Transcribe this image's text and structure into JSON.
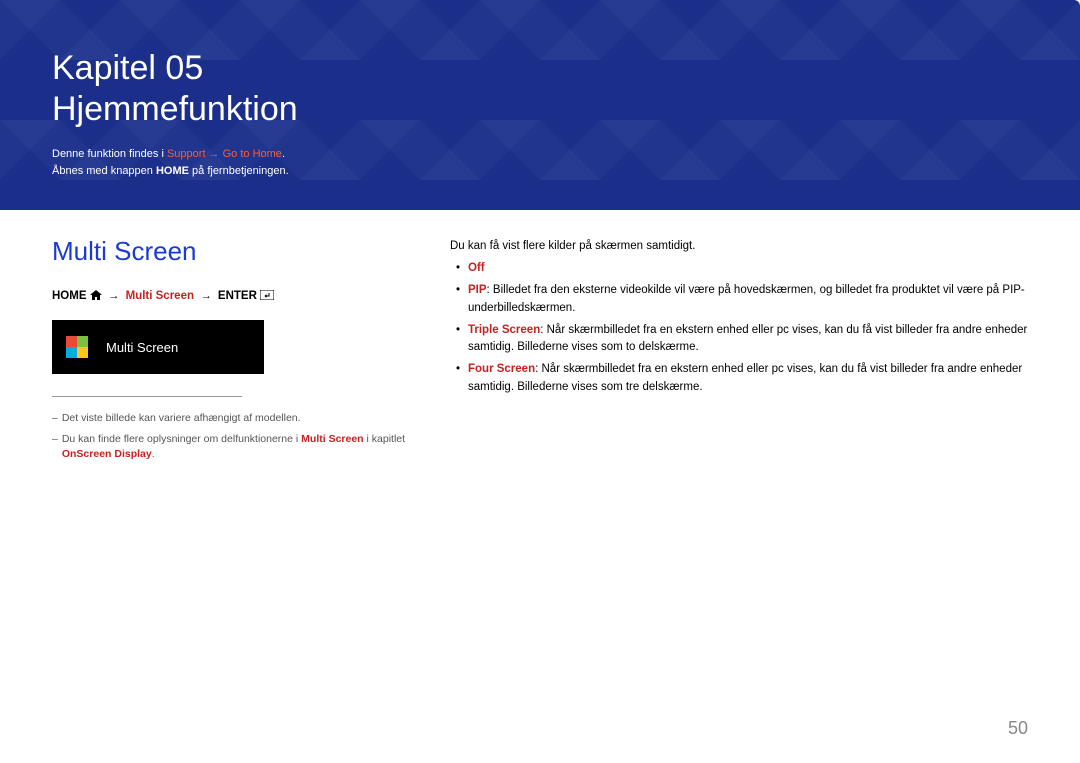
{
  "header": {
    "chapter_label": "Kapitel 05",
    "title": "Hjemmefunktion",
    "intro_line1_prefix": "Denne funktion findes i ",
    "intro_line1_hl1": "Support",
    "intro_line1_arrow": " → ",
    "intro_line1_hl2": "Go to Home",
    "intro_line1_suffix": ".",
    "intro_line2_prefix": "Åbnes med knappen ",
    "intro_line2_bold": "HOME",
    "intro_line2_suffix": " på fjernbetjeningen."
  },
  "left": {
    "section_title": "Multi Screen",
    "breadcrumb": {
      "home_label": "HOME",
      "arrow": "→",
      "mid": "Multi Screen",
      "enter_label": "ENTER"
    },
    "screenshot_label": "Multi Screen",
    "footnote1": "Det viste billede kan variere afhængigt af modellen.",
    "footnote2_prefix": "Du kan finde flere oplysninger om delfunktionerne i ",
    "footnote2_red1": "Multi Screen",
    "footnote2_mid": " i kapitlet ",
    "footnote2_red2": "OnScreen Display",
    "footnote2_suffix": "."
  },
  "right": {
    "intro": "Du kan få vist flere kilder på skærmen samtidigt.",
    "items": {
      "off": "Off",
      "pip_label": "PIP",
      "pip_text": ": Billedet fra den eksterne videokilde vil være på hovedskærmen, og billedet fra produktet vil være på PIP-underbilledskærmen.",
      "triple_label": "Triple Screen",
      "triple_text": ": Når skærmbilledet fra en ekstern enhed eller pc vises, kan du få vist billeder fra andre enheder samtidig. Billederne vises som to delskærme.",
      "four_label": "Four Screen",
      "four_text": ": Når skærmbilledet fra en ekstern enhed eller pc vises, kan du få vist billeder fra andre enheder samtidig. Billederne vises som tre delskærme."
    }
  },
  "page_number": "50"
}
